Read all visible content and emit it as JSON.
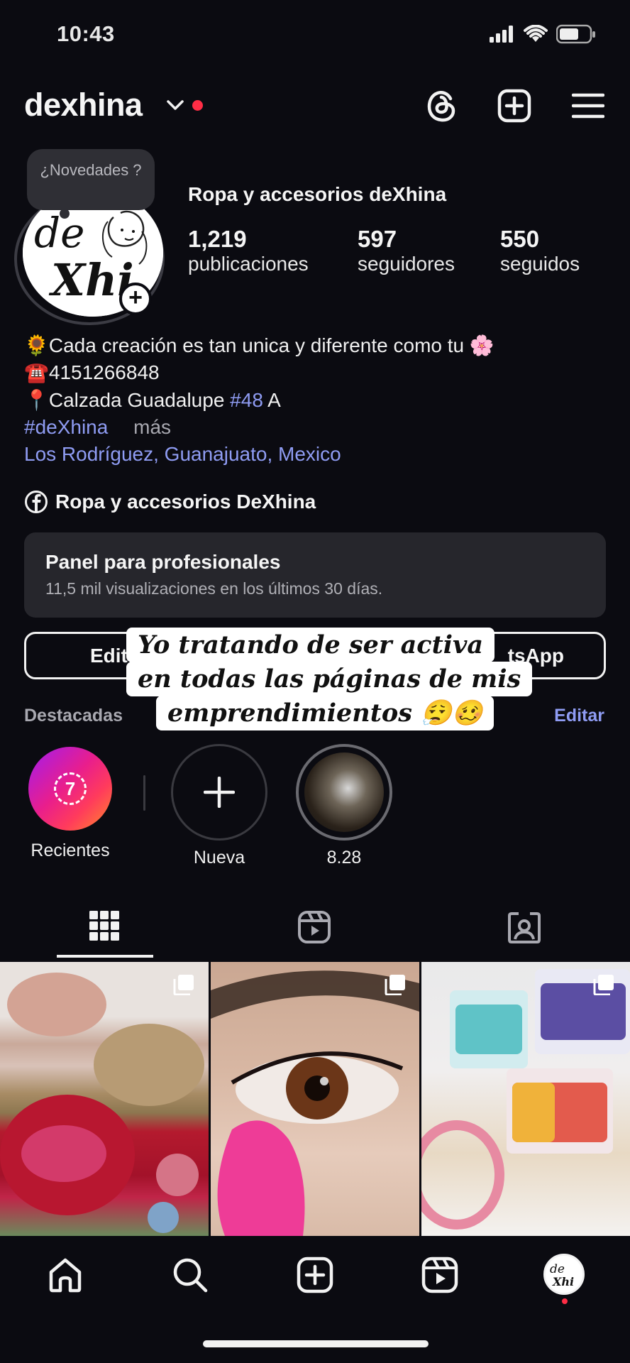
{
  "status": {
    "time": "10:43"
  },
  "header": {
    "username": "dexhina"
  },
  "notes_bubble": {
    "text": "¿Novedades ?"
  },
  "profile": {
    "display_name": "Ropa y accesorios deXhina",
    "stats": [
      {
        "value": "1,219",
        "label": "publicaciones"
      },
      {
        "value": "597",
        "label": "seguidores"
      },
      {
        "value": "550",
        "label": "seguidos"
      }
    ]
  },
  "bio": {
    "line1": "Cada creación es tan unica y diferente como tu",
    "line2": "4151266848",
    "line3_prefix": "Calzada Guadalupe",
    "line3_tag": "#48",
    "line3_suffix": "A",
    "hashtag": "#deXhina",
    "more": "más",
    "location": "Los Rodríguez, Guanajuato, Mexico",
    "emoji1": "🌻",
    "emoji2": "🌸",
    "emoji3": "☎️",
    "emoji4": "📍"
  },
  "facebook": {
    "label": "Ropa y accesorios DeXhina"
  },
  "panel": {
    "title": "Panel para profesionales",
    "subtitle": "11,5 mil visualizaciones en los últimos 30 días."
  },
  "buttons": {
    "edit_partial": "Edit",
    "whatsapp_partial": "tsApp"
  },
  "caption": {
    "line1": "Yo tratando de ser activa",
    "line2": "en todas las páginas de mis",
    "line3": "emprendimientos 😮‍💨🥴"
  },
  "highlights": {
    "title": "Destacadas",
    "edit": "Editar",
    "items": [
      {
        "label": "Recientes",
        "badge": "7"
      },
      {
        "label": "Nueva"
      },
      {
        "label": "8.28"
      }
    ]
  },
  "colors": {
    "link": "#8f9cf3",
    "background": "#0b0b11",
    "notification_dot": "#ff2d45"
  }
}
